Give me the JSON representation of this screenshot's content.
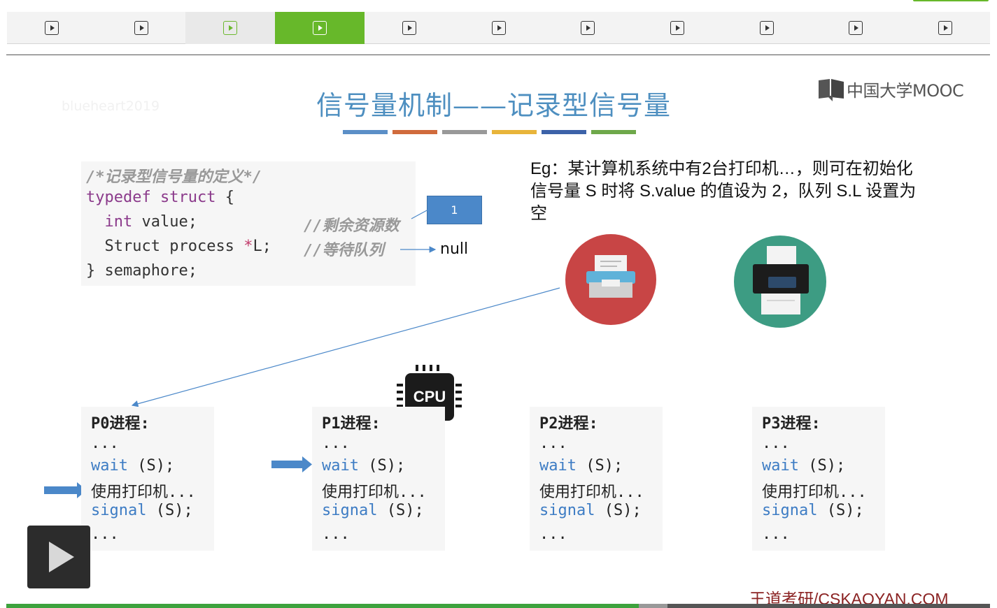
{
  "nav": {
    "tab_count": 11,
    "visited_index": 2,
    "active_index": 3
  },
  "slide": {
    "watermark": "blueheart2019",
    "title": "信号量机制——记录型信号量",
    "title_bar_colors": [
      "#5b8fc7",
      "#d06b3c",
      "#999999",
      "#e8b43a",
      "#3c62a8",
      "#6ea84a"
    ],
    "logo_text": "中国大学MOOC",
    "code": {
      "comment_line": "/*记录型信号量的定义*/",
      "typedef": "typedef",
      "struct": "struct",
      "open_brace": " {",
      "int_kw": "int",
      "value_decl": " value;",
      "value_comment": "//剩余资源数",
      "process_decl_a": "Struct process ",
      "process_ptr": "*",
      "process_decl_b": "L;",
      "queue_comment": "//等待队列",
      "close": "} semaphore;"
    },
    "value_box": "1",
    "null_label": "null",
    "example": "Eg：某计算机系统中有2台打印机…，则可在初始化信号量 S 时将 S.value 的值设为 2，队列 S.L 设置为空",
    "cpu_label": "CPU",
    "processes": [
      {
        "title": "P0进程:",
        "dots1": "...",
        "wait": "wait",
        "wait_arg": " (S);",
        "use": "使用打印机...",
        "signal": "signal",
        "signal_arg": " (S);",
        "dots2": "..."
      },
      {
        "title": "P1进程:",
        "dots1": "...",
        "wait": "wait",
        "wait_arg": " (S);",
        "use": "使用打印机...",
        "signal": "signal",
        "signal_arg": " (S);",
        "dots2": "..."
      },
      {
        "title": "P2进程:",
        "dots1": "...",
        "wait": "wait",
        "wait_arg": " (S);",
        "use": "使用打印机...",
        "signal": "signal",
        "signal_arg": " (S);",
        "dots2": "..."
      },
      {
        "title": "P3进程:",
        "dots1": "...",
        "wait": "wait",
        "wait_arg": " (S);",
        "use": "使用打印机...",
        "signal": "signal",
        "signal_arg": " (S);",
        "dots2": "..."
      }
    ],
    "footer": "王道考研/CSKAOYAN.COM"
  },
  "player": {
    "progress_fraction": 0.643,
    "buffer_fraction": 0.672,
    "progress_color": "#3da23d"
  }
}
